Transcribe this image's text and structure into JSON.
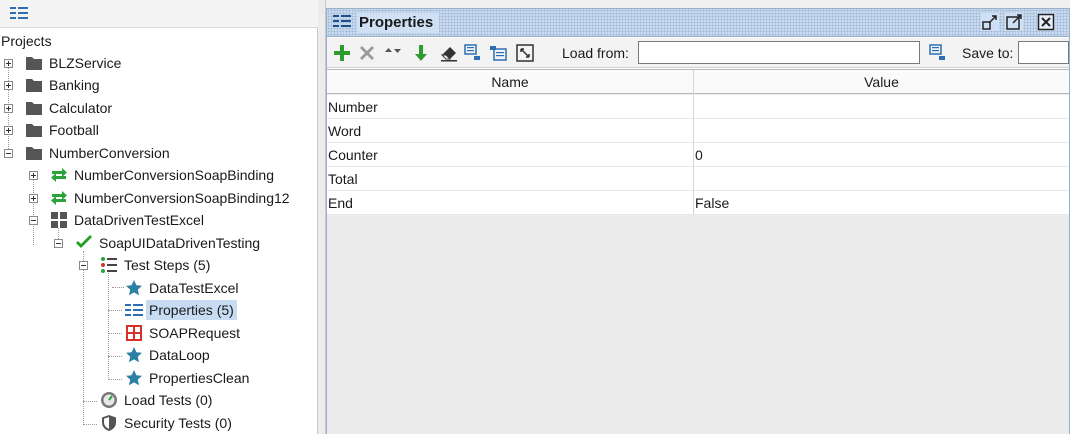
{
  "navigator": {
    "root_label": "Projects",
    "projects": [
      {
        "label": "BLZService"
      },
      {
        "label": "Banking"
      },
      {
        "label": "Calculator"
      },
      {
        "label": "Football"
      },
      {
        "label": "NumberConversion"
      }
    ],
    "number_conversion_children": [
      {
        "label": "NumberConversionSoapBinding"
      },
      {
        "label": "NumberConversionSoapBinding12"
      },
      {
        "label": "DataDrivenTestExcel"
      }
    ],
    "test_case": {
      "label": "SoapUIDataDrivenTesting"
    },
    "test_steps": {
      "label": "Test Steps (5)",
      "items": [
        {
          "label": "DataTestExcel"
        },
        {
          "label": "Properties (5)"
        },
        {
          "label": "SOAPRequest"
        },
        {
          "label": "DataLoop"
        },
        {
          "label": "PropertiesClean"
        }
      ]
    },
    "load_tests": {
      "label": "Load Tests (0)"
    },
    "security_tests": {
      "label": "Security Tests (0)"
    }
  },
  "panel": {
    "title": "Properties",
    "toolbar": {
      "load_from_label": "Load from:",
      "load_from_value": "",
      "save_to_label": "Save to:",
      "save_to_value": ""
    },
    "table": {
      "headers": [
        "Name",
        "Value"
      ],
      "rows": [
        {
          "name": "Number",
          "value": ""
        },
        {
          "name": "Word",
          "value": ""
        },
        {
          "name": "Counter",
          "value": "0"
        },
        {
          "name": "Total",
          "value": ""
        },
        {
          "name": "End",
          "value": "False"
        }
      ]
    }
  },
  "colors": {
    "selection": "#c7dcf2",
    "title_bar": "#cfe0f5",
    "add_green": "#2e9b2e",
    "check_green": "#23a023",
    "star_teal": "#2c7fa5",
    "request_red": "#d6302a",
    "interface_green": "#2aa43a"
  }
}
